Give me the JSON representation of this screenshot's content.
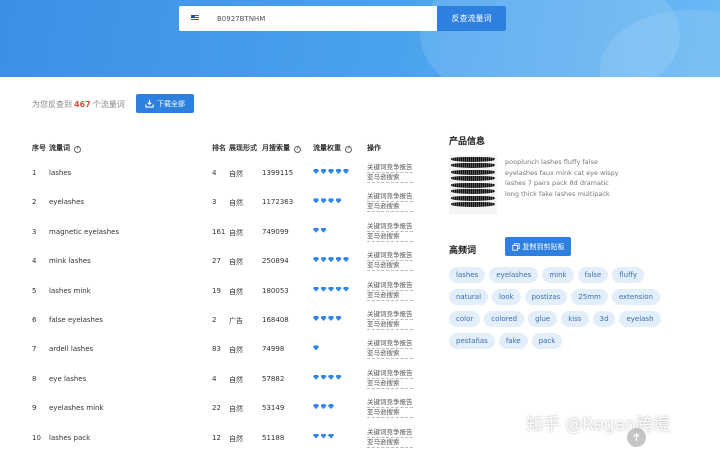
{
  "search": {
    "value": "B0927BTNHM",
    "button_label": "反查流量词",
    "flag": "us-flag-icon"
  },
  "summary": {
    "prefix": "为您反查到",
    "count": "467",
    "suffix": "个流量词",
    "download_label": "下载全部"
  },
  "table": {
    "headers": {
      "index": "序号",
      "keyword": "流量词",
      "rank": "排名",
      "form": "展现形式",
      "volume": "月搜索量",
      "weight": "流量权重",
      "operation": "操作"
    },
    "op_label_1": "关键词竞争报告",
    "op_label_2": "亚马逊搜索",
    "rows": [
      {
        "index": "1",
        "keyword": "lashes",
        "rank": "4",
        "form": "自然",
        "volume": "1399115",
        "weight": 5
      },
      {
        "index": "2",
        "keyword": "eyelashes",
        "rank": "3",
        "form": "自然",
        "volume": "1172363",
        "weight": 4
      },
      {
        "index": "3",
        "keyword": "magnetic eyelashes",
        "rank": "161",
        "form": "自然",
        "volume": "749099",
        "weight": 2
      },
      {
        "index": "4",
        "keyword": "mink lashes",
        "rank": "27",
        "form": "自然",
        "volume": "250894",
        "weight": 5
      },
      {
        "index": "5",
        "keyword": "lashes mink",
        "rank": "19",
        "form": "自然",
        "volume": "180053",
        "weight": 5
      },
      {
        "index": "6",
        "keyword": "false eyelashes",
        "rank": "2",
        "form": "广告",
        "volume": "168408",
        "weight": 4
      },
      {
        "index": "7",
        "keyword": "ardell lashes",
        "rank": "83",
        "form": "自然",
        "volume": "74998",
        "weight": 1
      },
      {
        "index": "8",
        "keyword": "eye lashes",
        "rank": "4",
        "form": "自然",
        "volume": "57882",
        "weight": 4
      },
      {
        "index": "9",
        "keyword": "eyelashes mink",
        "rank": "22",
        "form": "自然",
        "volume": "53149",
        "weight": 3
      },
      {
        "index": "10",
        "keyword": "lashes pack",
        "rank": "12",
        "form": "自然",
        "volume": "51188",
        "weight": 3
      }
    ]
  },
  "product": {
    "title": "产品信息",
    "lines": [
      "pooplunch lashes fluffy false",
      "eyelashes faux mink cat eye wispy",
      "lashes 7 pairs pack 8d dramatic",
      "long thick fake lashes multipack"
    ]
  },
  "keywords": {
    "title": "高频词",
    "copy_label": "复制到剪贴板",
    "tags": [
      "lashes",
      "eyelashes",
      "mink",
      "false",
      "fluffy",
      "natural",
      "look",
      "postizas",
      "25mm",
      "extension",
      "color",
      "colored",
      "glue",
      "kiss",
      "3d",
      "eyelash",
      "pestañas",
      "fake",
      "pack"
    ]
  },
  "watermark": "知乎 @Regan跨境"
}
